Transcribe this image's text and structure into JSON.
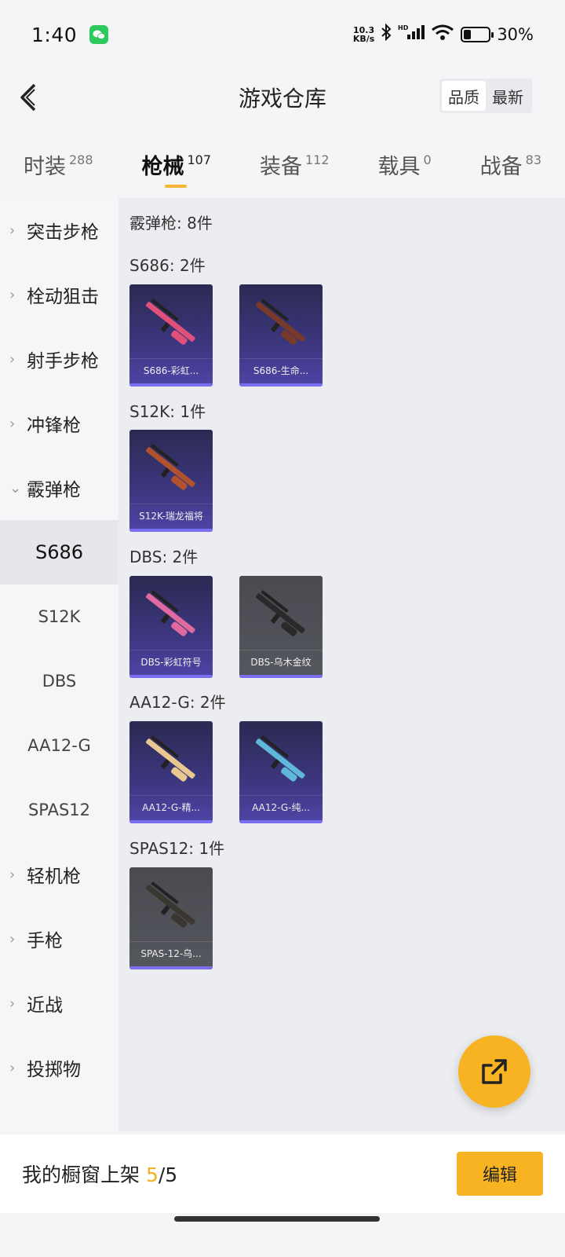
{
  "status": {
    "time": "1:40",
    "net_speed_value": "10.3",
    "net_speed_unit": "KB/s",
    "battery_level": 0.3,
    "battery_text": "30%"
  },
  "header": {
    "title": "游戏仓库",
    "sort_options": [
      "品质",
      "最新"
    ],
    "sort_active": "品质"
  },
  "tabs": [
    {
      "label": "时装",
      "count": "288"
    },
    {
      "label": "枪械",
      "count": "107"
    },
    {
      "label": "装备",
      "count": "112"
    },
    {
      "label": "载具",
      "count": "0"
    },
    {
      "label": "战备",
      "count": "83"
    }
  ],
  "active_tab": "枪械",
  "sidebar": {
    "categories": [
      "突击步枪",
      "栓动狙击",
      "射手步枪",
      "冲锋枪",
      "霰弹枪"
    ],
    "expanded": "霰弹枪",
    "subitems": [
      "S686",
      "S12K",
      "DBS",
      "AA12-G",
      "SPAS12"
    ],
    "active_sub": "S686",
    "categories_after": [
      "轻机枪",
      "手枪",
      "近战",
      "投掷物"
    ]
  },
  "content": {
    "category_total": "霰弹枪: 8件",
    "groups": [
      {
        "header": "S686: 2件",
        "items": [
          {
            "name": "S686-彩虹...",
            "rarity": "purple",
            "color": "#e0507a"
          },
          {
            "name": "S686-生命...",
            "rarity": "purple",
            "color": "#7a3a2a"
          }
        ]
      },
      {
        "header": "S12K: 1件",
        "items": [
          {
            "name": "S12K-瑞龙福将",
            "rarity": "purple",
            "color": "#b0522e"
          }
        ]
      },
      {
        "header": "DBS: 2件",
        "items": [
          {
            "name": "DBS-彩虹符号",
            "rarity": "purple",
            "color": "#e06aa0"
          },
          {
            "name": "DBS-乌木金纹",
            "rarity": "gray",
            "color": "#2a2a2a"
          }
        ]
      },
      {
        "header": "AA12-G: 2件",
        "items": [
          {
            "name": "AA12-G-精...",
            "rarity": "purple",
            "color": "#e8c890"
          },
          {
            "name": "AA12-G-纯...",
            "rarity": "purple",
            "color": "#5fb8d8"
          }
        ]
      },
      {
        "header": "SPAS12: 1件",
        "items": [
          {
            "name": "SPAS-12-乌...",
            "rarity": "gray",
            "color": "#3a3630"
          }
        ]
      }
    ]
  },
  "bottom": {
    "showcase_label": "我的橱窗上架",
    "showcase_used": "5",
    "showcase_total": "/5",
    "edit_label": "编辑"
  }
}
